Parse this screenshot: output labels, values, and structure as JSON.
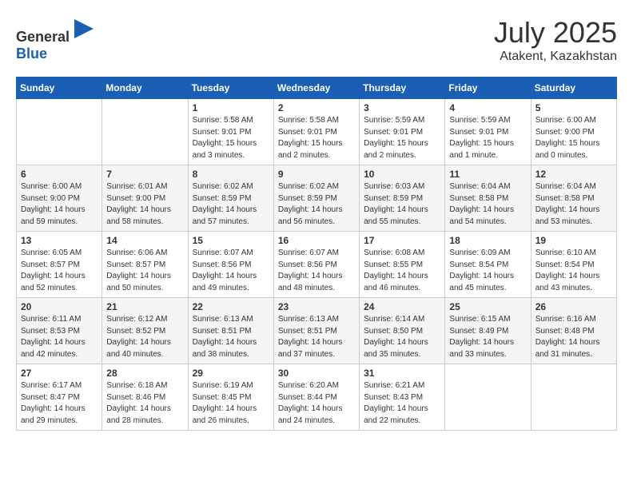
{
  "header": {
    "logo_general": "General",
    "logo_blue": "Blue",
    "month": "July 2025",
    "location": "Atakent, Kazakhstan"
  },
  "weekdays": [
    "Sunday",
    "Monday",
    "Tuesday",
    "Wednesday",
    "Thursday",
    "Friday",
    "Saturday"
  ],
  "weeks": [
    [
      {
        "day": "",
        "info": ""
      },
      {
        "day": "",
        "info": ""
      },
      {
        "day": "1",
        "info": "Sunrise: 5:58 AM\nSunset: 9:01 PM\nDaylight: 15 hours\nand 3 minutes."
      },
      {
        "day": "2",
        "info": "Sunrise: 5:58 AM\nSunset: 9:01 PM\nDaylight: 15 hours\nand 2 minutes."
      },
      {
        "day": "3",
        "info": "Sunrise: 5:59 AM\nSunset: 9:01 PM\nDaylight: 15 hours\nand 2 minutes."
      },
      {
        "day": "4",
        "info": "Sunrise: 5:59 AM\nSunset: 9:01 PM\nDaylight: 15 hours\nand 1 minute."
      },
      {
        "day": "5",
        "info": "Sunrise: 6:00 AM\nSunset: 9:00 PM\nDaylight: 15 hours\nand 0 minutes."
      }
    ],
    [
      {
        "day": "6",
        "info": "Sunrise: 6:00 AM\nSunset: 9:00 PM\nDaylight: 14 hours\nand 59 minutes."
      },
      {
        "day": "7",
        "info": "Sunrise: 6:01 AM\nSunset: 9:00 PM\nDaylight: 14 hours\nand 58 minutes."
      },
      {
        "day": "8",
        "info": "Sunrise: 6:02 AM\nSunset: 8:59 PM\nDaylight: 14 hours\nand 57 minutes."
      },
      {
        "day": "9",
        "info": "Sunrise: 6:02 AM\nSunset: 8:59 PM\nDaylight: 14 hours\nand 56 minutes."
      },
      {
        "day": "10",
        "info": "Sunrise: 6:03 AM\nSunset: 8:59 PM\nDaylight: 14 hours\nand 55 minutes."
      },
      {
        "day": "11",
        "info": "Sunrise: 6:04 AM\nSunset: 8:58 PM\nDaylight: 14 hours\nand 54 minutes."
      },
      {
        "day": "12",
        "info": "Sunrise: 6:04 AM\nSunset: 8:58 PM\nDaylight: 14 hours\nand 53 minutes."
      }
    ],
    [
      {
        "day": "13",
        "info": "Sunrise: 6:05 AM\nSunset: 8:57 PM\nDaylight: 14 hours\nand 52 minutes."
      },
      {
        "day": "14",
        "info": "Sunrise: 6:06 AM\nSunset: 8:57 PM\nDaylight: 14 hours\nand 50 minutes."
      },
      {
        "day": "15",
        "info": "Sunrise: 6:07 AM\nSunset: 8:56 PM\nDaylight: 14 hours\nand 49 minutes."
      },
      {
        "day": "16",
        "info": "Sunrise: 6:07 AM\nSunset: 8:56 PM\nDaylight: 14 hours\nand 48 minutes."
      },
      {
        "day": "17",
        "info": "Sunrise: 6:08 AM\nSunset: 8:55 PM\nDaylight: 14 hours\nand 46 minutes."
      },
      {
        "day": "18",
        "info": "Sunrise: 6:09 AM\nSunset: 8:54 PM\nDaylight: 14 hours\nand 45 minutes."
      },
      {
        "day": "19",
        "info": "Sunrise: 6:10 AM\nSunset: 8:54 PM\nDaylight: 14 hours\nand 43 minutes."
      }
    ],
    [
      {
        "day": "20",
        "info": "Sunrise: 6:11 AM\nSunset: 8:53 PM\nDaylight: 14 hours\nand 42 minutes."
      },
      {
        "day": "21",
        "info": "Sunrise: 6:12 AM\nSunset: 8:52 PM\nDaylight: 14 hours\nand 40 minutes."
      },
      {
        "day": "22",
        "info": "Sunrise: 6:13 AM\nSunset: 8:51 PM\nDaylight: 14 hours\nand 38 minutes."
      },
      {
        "day": "23",
        "info": "Sunrise: 6:13 AM\nSunset: 8:51 PM\nDaylight: 14 hours\nand 37 minutes."
      },
      {
        "day": "24",
        "info": "Sunrise: 6:14 AM\nSunset: 8:50 PM\nDaylight: 14 hours\nand 35 minutes."
      },
      {
        "day": "25",
        "info": "Sunrise: 6:15 AM\nSunset: 8:49 PM\nDaylight: 14 hours\nand 33 minutes."
      },
      {
        "day": "26",
        "info": "Sunrise: 6:16 AM\nSunset: 8:48 PM\nDaylight: 14 hours\nand 31 minutes."
      }
    ],
    [
      {
        "day": "27",
        "info": "Sunrise: 6:17 AM\nSunset: 8:47 PM\nDaylight: 14 hours\nand 29 minutes."
      },
      {
        "day": "28",
        "info": "Sunrise: 6:18 AM\nSunset: 8:46 PM\nDaylight: 14 hours\nand 28 minutes."
      },
      {
        "day": "29",
        "info": "Sunrise: 6:19 AM\nSunset: 8:45 PM\nDaylight: 14 hours\nand 26 minutes."
      },
      {
        "day": "30",
        "info": "Sunrise: 6:20 AM\nSunset: 8:44 PM\nDaylight: 14 hours\nand 24 minutes."
      },
      {
        "day": "31",
        "info": "Sunrise: 6:21 AM\nSunset: 8:43 PM\nDaylight: 14 hours\nand 22 minutes."
      },
      {
        "day": "",
        "info": ""
      },
      {
        "day": "",
        "info": ""
      }
    ]
  ]
}
